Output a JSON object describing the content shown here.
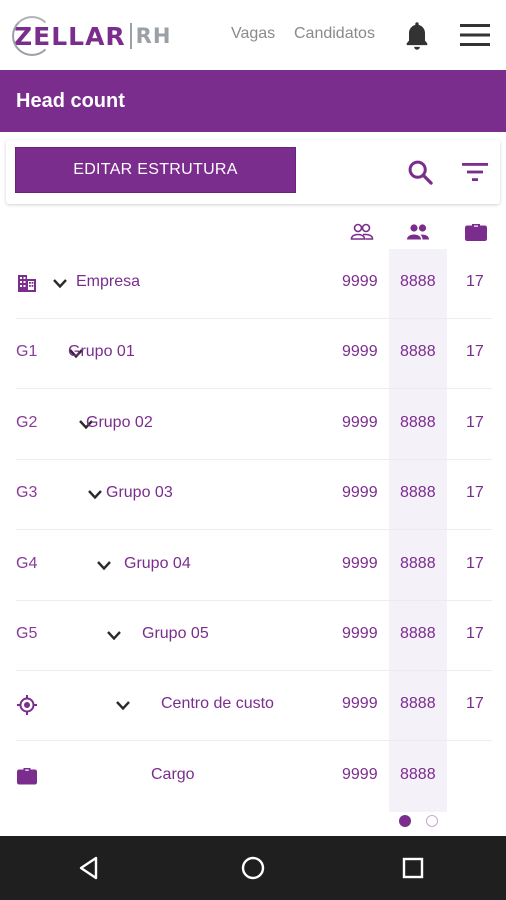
{
  "header": {
    "logo_text": "ZELLAR",
    "logo_suffix": "RH",
    "nav": [
      "Vagas",
      "Candidatos"
    ],
    "icons": [
      "bell-icon",
      "hamburger-menu-icon"
    ]
  },
  "page": {
    "title": "Head count"
  },
  "toolbar": {
    "edit_label": "EDITAR ESTRUTURA",
    "icons": [
      "search-icon",
      "filter-icon"
    ]
  },
  "columns": {
    "icons": [
      "people-outline-icon",
      "people-filled-icon",
      "briefcase-icon"
    ]
  },
  "rows": [
    {
      "code": "",
      "code_icon": "building-icon",
      "label": "Empresa",
      "chevron": true,
      "n1": "9999",
      "n2": "8888",
      "n3": "17"
    },
    {
      "code": "G1",
      "label": "Grupo 01",
      "chevron": true,
      "n1": "9999",
      "n2": "8888",
      "n3": "17"
    },
    {
      "code": "G2",
      "label": "Grupo 02",
      "chevron": true,
      "n1": "9999",
      "n2": "8888",
      "n3": "17"
    },
    {
      "code": "G3",
      "label": "Grupo 03",
      "chevron": true,
      "n1": "9999",
      "n2": "8888",
      "n3": "17"
    },
    {
      "code": "G4",
      "label": "Grupo 04",
      "chevron": true,
      "n1": "9999",
      "n2": "8888",
      "n3": "17"
    },
    {
      "code": "G5",
      "label": "Grupo 05",
      "chevron": true,
      "n1": "9999",
      "n2": "8888",
      "n3": "17"
    },
    {
      "code": "",
      "code_icon": "target-icon",
      "label": "Centro de custo",
      "chevron": true,
      "n1": "9999",
      "n2": "8888",
      "n3": "17"
    },
    {
      "code": "",
      "code_icon": "briefcase-icon",
      "label": "Cargo",
      "chevron": false,
      "n1": "9999",
      "n2": "8888",
      "n3": ""
    }
  ],
  "pager": {
    "pages": 2,
    "current": 1
  },
  "theme": {
    "accent": "#7b2d8e",
    "highlight": "#f4f1f8"
  },
  "android_nav": [
    "back-icon",
    "home-icon",
    "recents-icon"
  ]
}
